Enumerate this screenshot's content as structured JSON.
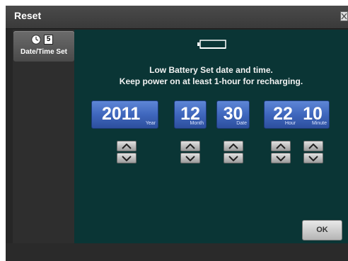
{
  "titlebar": {
    "title": "Reset"
  },
  "sidebar": {
    "item_label": "Date/Time Set",
    "calendar_digit": "5"
  },
  "main": {
    "message_line1": "Low Battery Set date and time.",
    "message_line2": "Keep power on at least 1-hour for recharging."
  },
  "fields": {
    "year": {
      "value": "2011",
      "unit": "Year"
    },
    "month": {
      "value": "12",
      "unit": "Month"
    },
    "date": {
      "value": "30",
      "unit": "Date"
    },
    "hour": {
      "value": "22",
      "unit": "Hour"
    },
    "minute": {
      "value": "10",
      "unit": "Minute"
    }
  },
  "ok_label": "OK",
  "colors": {
    "panel": "#0a3535",
    "value_box": "#3f67bd",
    "title_bar": "#3f3f3f"
  }
}
